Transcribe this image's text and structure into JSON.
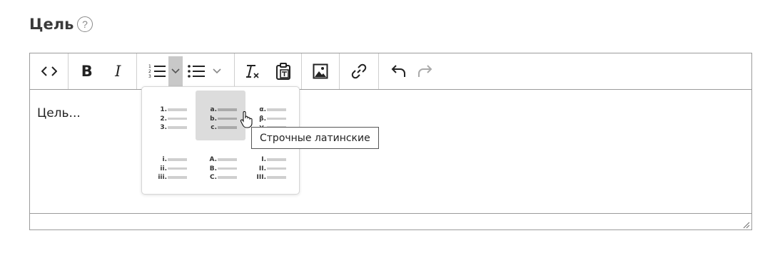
{
  "field": {
    "label": "Цель",
    "help_icon": "question-circle-icon"
  },
  "toolbar": {
    "icons": [
      "source-code-icon",
      "bold-icon",
      "italic-icon",
      "numbered-list-icon",
      "chevron-down-icon",
      "bulleted-list-icon",
      "chevron-down-icon",
      "clear-format-icon",
      "paste-text-icon",
      "image-icon",
      "link-icon",
      "undo-icon",
      "redo-icon"
    ]
  },
  "editor": {
    "content": "Цель..."
  },
  "list_styles": {
    "options": [
      {
        "id": "decimal",
        "markers": [
          "1.",
          "2.",
          "3."
        ]
      },
      {
        "id": "lower-alpha",
        "markers": [
          "a.",
          "b.",
          "c."
        ]
      },
      {
        "id": "lower-greek",
        "markers": [
          "α.",
          "β.",
          "γ."
        ]
      },
      {
        "id": "lower-roman",
        "markers": [
          "i.",
          "ii.",
          "iii."
        ]
      },
      {
        "id": "upper-alpha",
        "markers": [
          "A.",
          "B.",
          "C."
        ]
      },
      {
        "id": "upper-roman",
        "markers": [
          "I.",
          "II.",
          "III."
        ]
      }
    ],
    "hovered": "lower-alpha"
  },
  "tooltip": {
    "text": "Строчные латинские"
  },
  "colors": {
    "active_dropdown": "#c8c8c8",
    "hover_bg": "#dcdcdc",
    "border": "#9b9b9b"
  }
}
